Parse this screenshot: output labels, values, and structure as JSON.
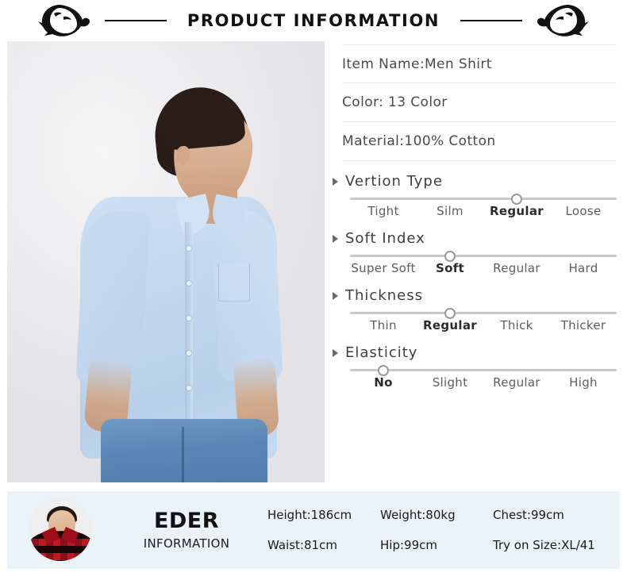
{
  "header": {
    "title": "PRODUCT INFORMATION",
    "logo_left": "panther-head-logo",
    "logo_right": "panther-head-logo"
  },
  "product_image": {
    "alt": "male model wearing light blue oxford shirt and blue jeans"
  },
  "specs": [
    {
      "text": "Item Name:Men Shirt"
    },
    {
      "text": "Color: 13 Color"
    },
    {
      "text": "Material:100% Cotton"
    }
  ],
  "sliders": [
    {
      "title": "Vertion Type",
      "options": [
        "Tight",
        "Silm",
        "Regular",
        "Loose"
      ],
      "selected_index": 2,
      "selected_value": "Regular"
    },
    {
      "title": "Soft Index",
      "options": [
        "Super Soft",
        "Soft",
        "Regular",
        "Hard"
      ],
      "selected_index": 1,
      "selected_value": "Soft"
    },
    {
      "title": "Thickness",
      "options": [
        "Thin",
        "Regular",
        "Thick",
        "Thicker"
      ],
      "selected_index": 1,
      "selected_value": "Regular"
    },
    {
      "title": "Elasticity",
      "options": [
        "No",
        "Slight",
        "Regular",
        "High"
      ],
      "selected_index": 0,
      "selected_value": "No"
    }
  ],
  "footer": {
    "avatar": "model-avatar-red-plaid-shirt",
    "brand_name": "EDER",
    "brand_sub": "INFORMATION",
    "measurements": [
      "Height:186cm",
      "Weight:80kg",
      "Chest:99cm",
      "Waist:81cm",
      "Hip:99cm",
      "Try on Size:XL/41"
    ]
  },
  "colors": {
    "footer_bg": "#eaf3f7",
    "shirt_blue": "#c3d8ef",
    "jeans_blue": "#5b87b6",
    "plaid_red": "#c01823",
    "divider": "#e8e8e8",
    "track": "#c9c9c9"
  }
}
